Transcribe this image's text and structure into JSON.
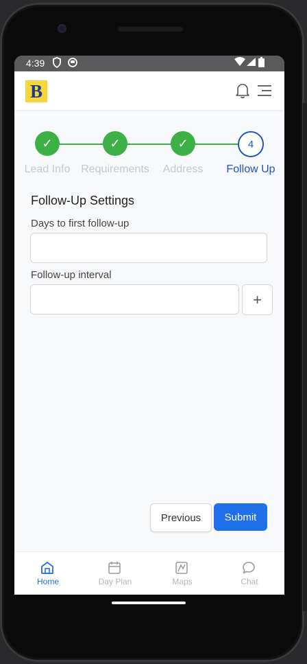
{
  "status_bar": {
    "time": "4:39"
  },
  "header": {
    "logo_letter": "B"
  },
  "stepper": {
    "steps": [
      {
        "label": "Lead Info",
        "state": "done",
        "marker": "✓"
      },
      {
        "label": "Requirements",
        "state": "done",
        "marker": "✓"
      },
      {
        "label": "Address",
        "state": "done",
        "marker": "✓"
      },
      {
        "label": "Follow Up",
        "state": "active",
        "marker": "4"
      }
    ]
  },
  "form": {
    "title": "Follow-Up Settings",
    "days_label": "Days to first follow-up",
    "days_value": "",
    "interval_label": "Follow-up interval",
    "interval_value": "",
    "add_glyph": "+"
  },
  "actions": {
    "previous": "Previous",
    "submit": "Submit"
  },
  "bottom_nav": {
    "items": [
      {
        "label": "Home",
        "icon": "home-icon",
        "active": true
      },
      {
        "label": "Day Plan",
        "icon": "calendar-icon",
        "active": false
      },
      {
        "label": "Maps",
        "icon": "map-icon",
        "active": false
      },
      {
        "label": "Chat",
        "icon": "chat-icon",
        "active": false
      }
    ]
  },
  "colors": {
    "accent": "#1f6fe8",
    "step_done": "#3cb044",
    "step_active": "#1f54c4",
    "logo_bg": "#f6d63a"
  }
}
